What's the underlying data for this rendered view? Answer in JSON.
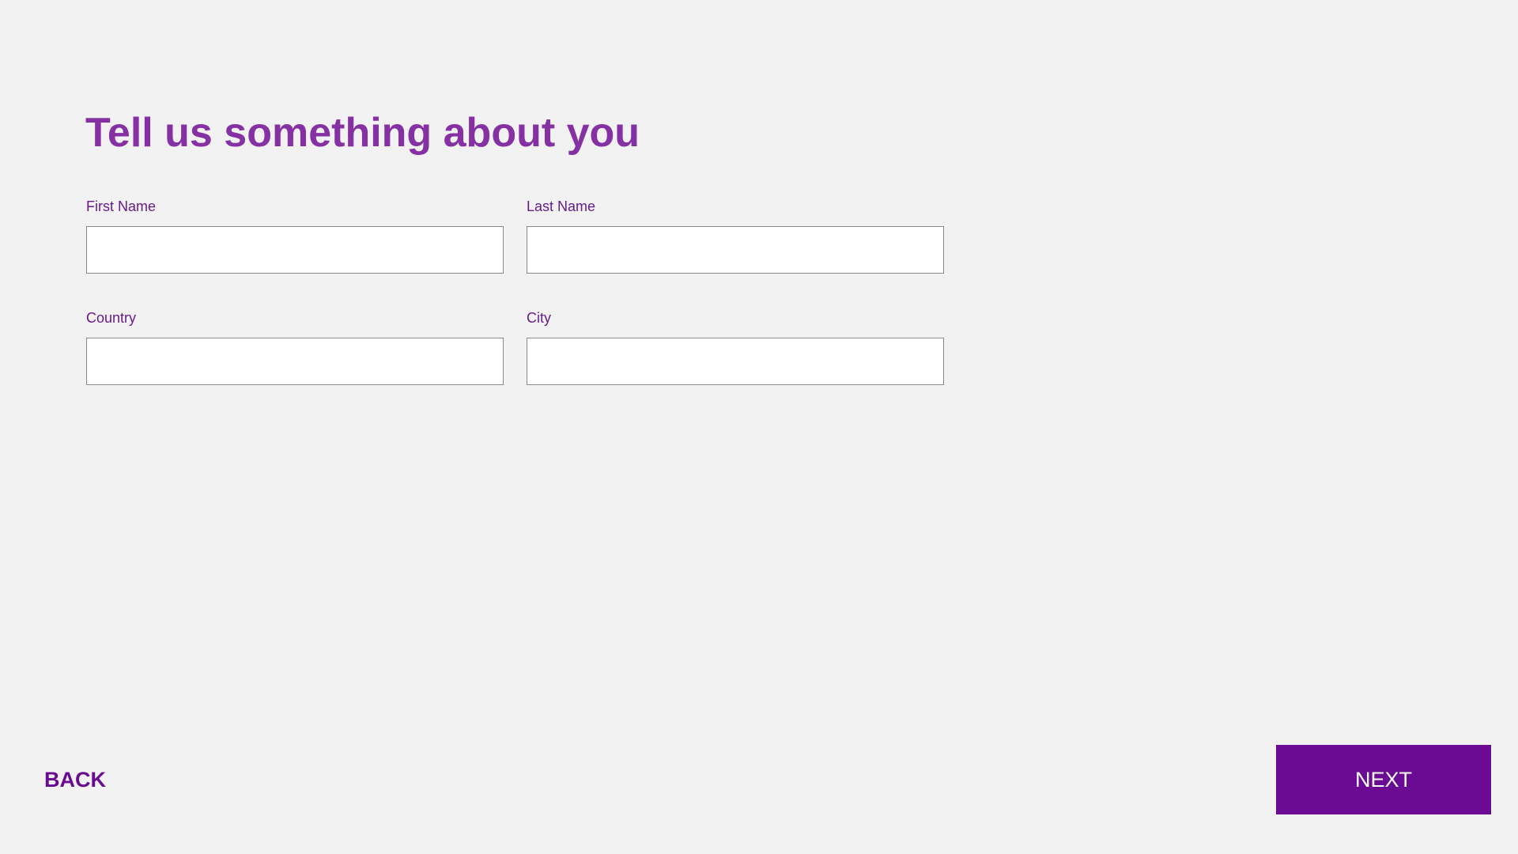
{
  "form": {
    "title": "Tell us something about you",
    "fields": {
      "first_name": {
        "label": "First Name",
        "value": "",
        "placeholder": ""
      },
      "last_name": {
        "label": "Last Name",
        "value": "",
        "placeholder": ""
      },
      "country": {
        "label": "Country",
        "value": "",
        "placeholder": ""
      },
      "city": {
        "label": "City",
        "value": "",
        "placeholder": ""
      }
    }
  },
  "navigation": {
    "back_label": "BACK",
    "next_label": "NEXT"
  },
  "colors": {
    "background": "#f2f2f2",
    "title": "#8530a3",
    "label": "#6a1b8a",
    "primary": "#6b0a93",
    "input_border": "#8a8a8a"
  }
}
